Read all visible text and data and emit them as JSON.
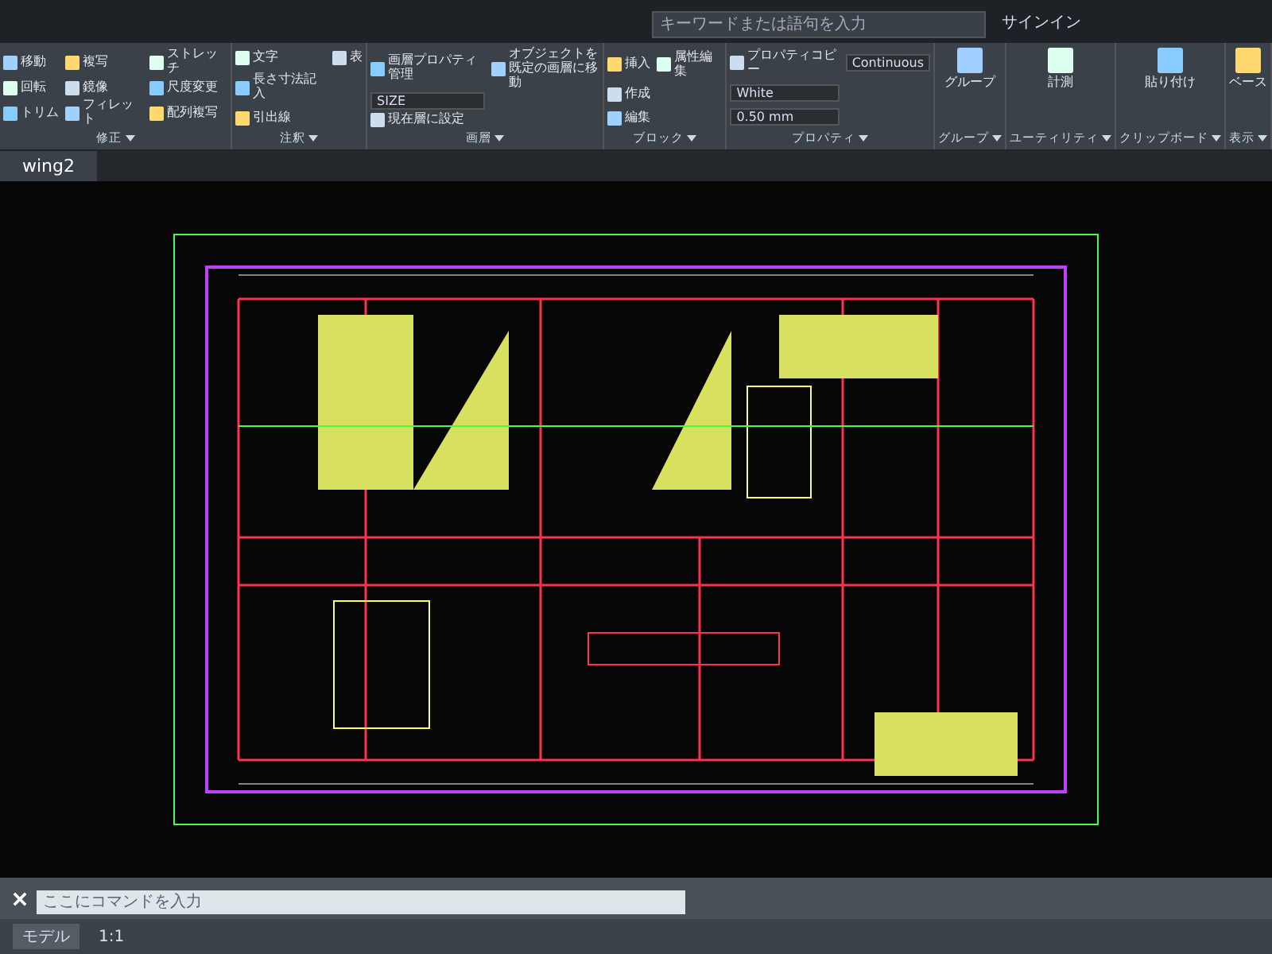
{
  "title_bar": {
    "search": {
      "placeholder": "キーワードまたは語句を入力"
    },
    "sign_in": "サインイン"
  },
  "ribbon": {
    "panels": [
      {
        "title": "修正",
        "tools": [
          {
            "label": "移動",
            "kind": "tool"
          },
          {
            "label": "回転",
            "kind": "tool"
          },
          {
            "label": "トリム",
            "kind": "tool"
          },
          {
            "label": "複写",
            "kind": "tool"
          },
          {
            "label": "鏡像",
            "kind": "tool"
          },
          {
            "label": "フィレット",
            "kind": "tool"
          },
          {
            "label": "ストレッチ",
            "kind": "tool"
          },
          {
            "label": "尺度変更",
            "kind": "tool"
          },
          {
            "label": "配列複写",
            "kind": "tool"
          }
        ]
      },
      {
        "title": "注釈",
        "tools": [
          {
            "label": "文字",
            "kind": "tool"
          },
          {
            "label": "長さ寸法記入",
            "kind": "tool"
          },
          {
            "label": "引出線",
            "kind": "tool"
          },
          {
            "label": "表",
            "kind": "tool"
          }
        ]
      },
      {
        "title": "画層",
        "tools": [
          {
            "label": "画層プロパティ管理",
            "kind": "tool"
          },
          {
            "label": "SIZE",
            "kind": "dropdown"
          },
          {
            "label": "現在層に設定",
            "kind": "tool"
          },
          {
            "label": "オブジェクトを既定の画層に移動",
            "kind": "tool"
          }
        ]
      },
      {
        "title": "ブロック",
        "tools": [
          {
            "label": "挿入",
            "kind": "tool"
          },
          {
            "label": "作成",
            "kind": "tool"
          },
          {
            "label": "編集",
            "kind": "tool"
          },
          {
            "label": "属性編集",
            "kind": "tool"
          }
        ]
      },
      {
        "title": "プロパティ",
        "tools": [
          {
            "label": "プロパティコピー",
            "kind": "tool"
          },
          {
            "label": "White",
            "kind": "dropdown"
          },
          {
            "label": "0.50 mm",
            "kind": "dropdown"
          },
          {
            "label": "Continuous",
            "kind": "dropdown"
          }
        ]
      },
      {
        "title": "グループ",
        "tools": [
          {
            "label": "グループ",
            "kind": "tool"
          }
        ]
      },
      {
        "title": "ユーティリティ",
        "tools": [
          {
            "label": "計測",
            "kind": "tool"
          }
        ]
      },
      {
        "title": "クリップボード",
        "tools": [
          {
            "label": "貼り付け",
            "kind": "tool"
          }
        ]
      },
      {
        "title": "表示",
        "tools": [
          {
            "label": "ベース",
            "kind": "tool"
          }
        ]
      }
    ]
  },
  "file_tab": {
    "label": "wing2",
    "selected": true
  },
  "command_line": {
    "placeholder": "ここにコマンドを入力"
  },
  "status_bar": {
    "model_tab": "モデル",
    "scale": "1:1"
  }
}
